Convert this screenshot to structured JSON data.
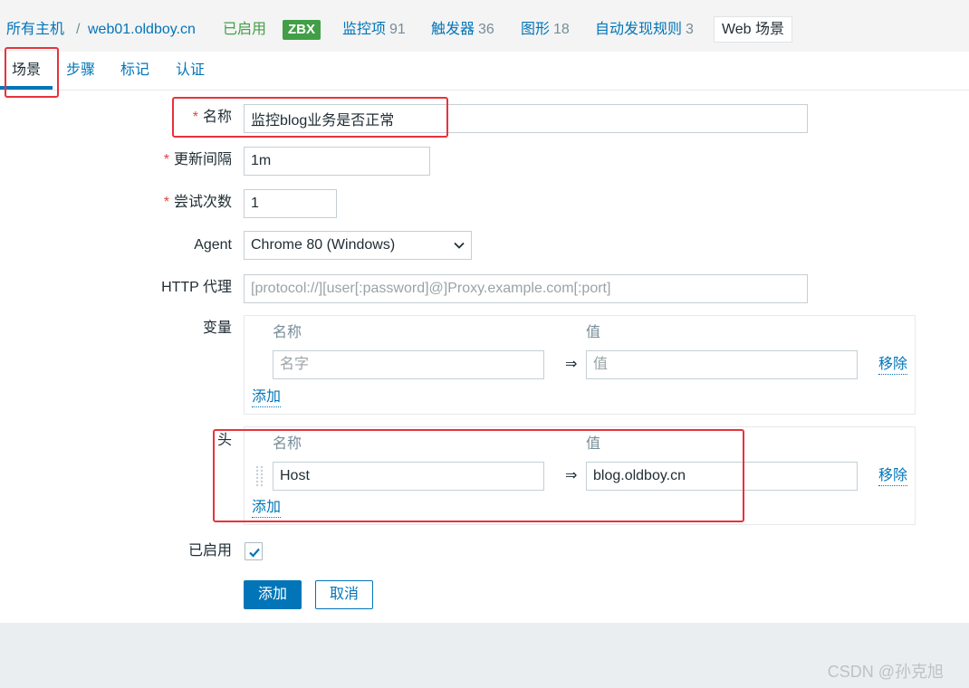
{
  "breadcrumb": {
    "all_hosts": "所有主机",
    "separator": "/",
    "host": "web01.oldboy.cn",
    "status": "已启用",
    "badge": "ZBX",
    "links": [
      {
        "label": "监控项",
        "count": "91"
      },
      {
        "label": "触发器",
        "count": "36"
      },
      {
        "label": "图形",
        "count": "18"
      },
      {
        "label": "自动发现规则",
        "count": "3"
      }
    ],
    "current": "Web 场景"
  },
  "tabs": [
    {
      "label": "场景",
      "active": true
    },
    {
      "label": "步骤",
      "active": false
    },
    {
      "label": "标记",
      "active": false
    },
    {
      "label": "认证",
      "active": false
    }
  ],
  "form": {
    "required_mark": "*",
    "name": {
      "label": "名称",
      "value": "监控blog业务是否正常",
      "required": true
    },
    "update_interval": {
      "label": "更新间隔",
      "value": "1m",
      "required": true
    },
    "attempts": {
      "label": "尝试次数",
      "value": "1",
      "required": true
    },
    "agent": {
      "label": "Agent",
      "selected": "Chrome 80 (Windows)"
    },
    "http_proxy": {
      "label": "HTTP 代理",
      "placeholder": "[protocol://][user[:password]@]Proxy.example.com[:port]"
    },
    "variables": {
      "label": "变量",
      "col_name": "名称",
      "col_value": "值",
      "rows": [
        {
          "name_placeholder": "名字",
          "arrow": "⇒",
          "value_placeholder": "值",
          "remove": "移除"
        }
      ],
      "add": "添加"
    },
    "headers": {
      "label": "头",
      "col_name": "名称",
      "col_value": "值",
      "rows": [
        {
          "name": "Host",
          "arrow": "⇒",
          "value": "blog.oldboy.cn",
          "remove": "移除"
        }
      ],
      "add": "添加"
    },
    "enabled": {
      "label": "已启用",
      "checked": true
    },
    "buttons": {
      "submit": "添加",
      "cancel": "取消"
    }
  },
  "watermark": "CSDN @孙克旭",
  "icons": {
    "agent_dropdown": "chevron-down-icon",
    "header_row_handle": "drag-handle-icon",
    "enabled_checkbox": "check-icon"
  },
  "colors": {
    "accent": "#0275b8",
    "enabled_green": "#429e47",
    "required_red": "#e54343",
    "muted": "#768d99",
    "annotation_red": "#e8323c",
    "footer_bg": "#ebeef0"
  }
}
